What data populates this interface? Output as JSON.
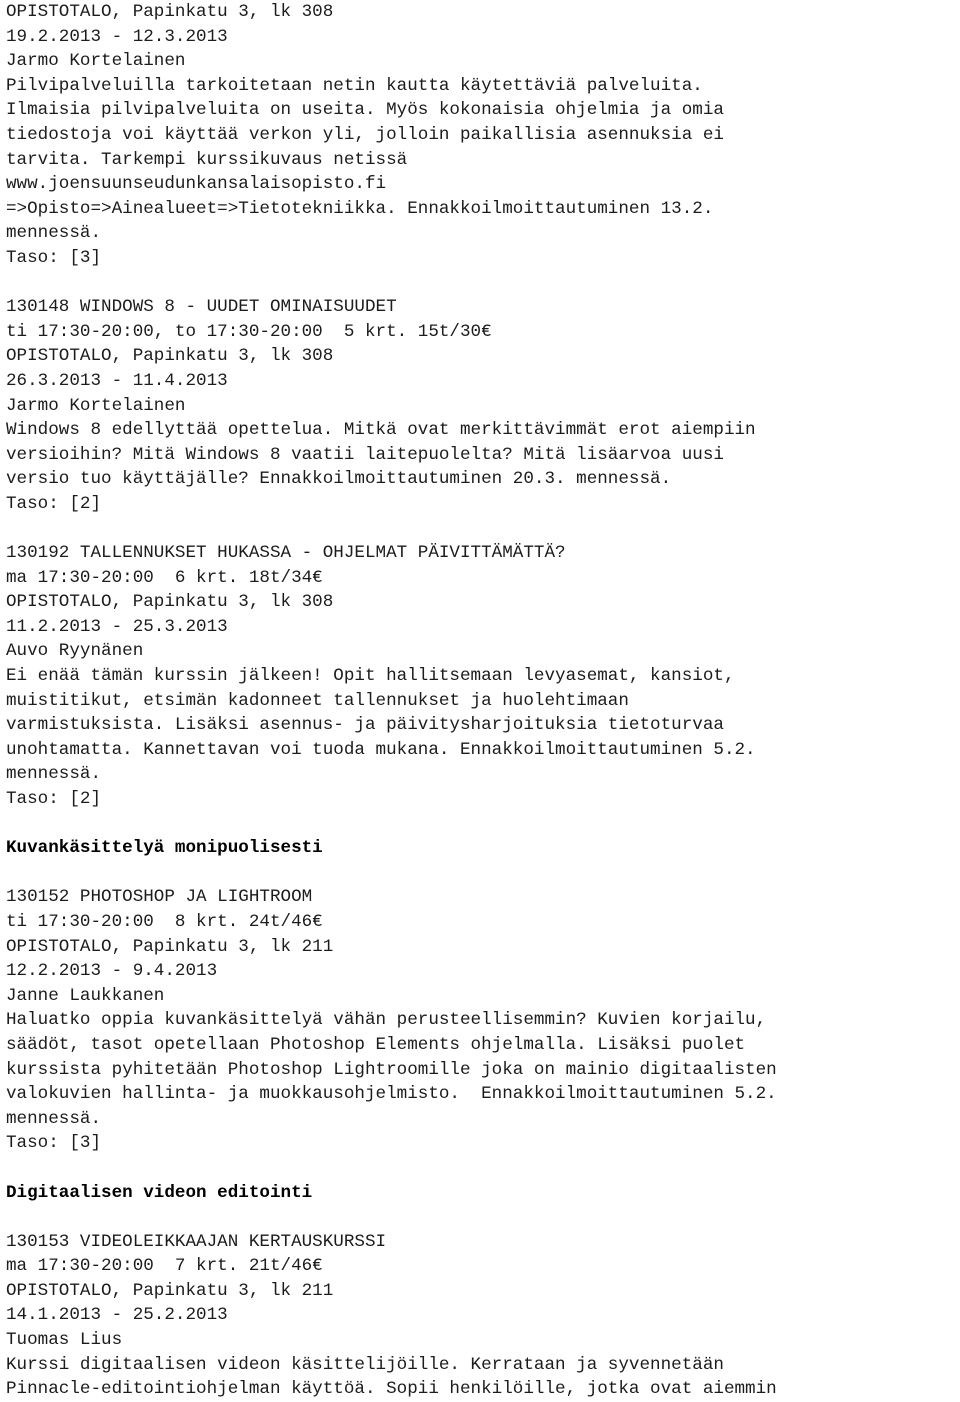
{
  "document": {
    "type": "course-catalog-listing",
    "language": "fi",
    "text_color": "#1c1c1c",
    "background_color": "#ffffff",
    "blocks": [
      {
        "kind": "line",
        "text": "OPISTOTALO, Papinkatu 3, lk 308"
      },
      {
        "kind": "line",
        "text": "19.2.2013 - 12.3.2013"
      },
      {
        "kind": "line",
        "text": "Jarmo Kortelainen"
      },
      {
        "kind": "line",
        "text": "Pilvipalveluilla tarkoitetaan netin kautta käytettäviä palveluita."
      },
      {
        "kind": "line",
        "text": "Ilmaisia pilvipalveluita on useita. Myös kokonaisia ohjelmia ja omia"
      },
      {
        "kind": "line",
        "text": "tiedostoja voi käyttää verkon yli, jolloin paikallisia asennuksia ei"
      },
      {
        "kind": "line",
        "text": "tarvita. Tarkempi kurssikuvaus netissä"
      },
      {
        "kind": "line",
        "text": "www.joensuunseudunkansalaisopisto.fi"
      },
      {
        "kind": "line",
        "text": "=>Opisto=>Ainealueet=>Tietotekniikka. Ennakkoilmoittautuminen 13.2."
      },
      {
        "kind": "line",
        "text": "mennessä."
      },
      {
        "kind": "line",
        "text": "Taso: [3]"
      },
      {
        "kind": "blank",
        "text": ""
      },
      {
        "kind": "line",
        "text": "130148 WINDOWS 8 - UUDET OMINAISUUDET"
      },
      {
        "kind": "line",
        "text": "ti 17:30-20:00, to 17:30-20:00  5 krt. 15t/30€"
      },
      {
        "kind": "line",
        "text": "OPISTOTALO, Papinkatu 3, lk 308"
      },
      {
        "kind": "line",
        "text": "26.3.2013 - 11.4.2013"
      },
      {
        "kind": "line",
        "text": "Jarmo Kortelainen"
      },
      {
        "kind": "line",
        "text": "Windows 8 edellyttää opettelua. Mitkä ovat merkittävimmät erot aiempiin"
      },
      {
        "kind": "line",
        "text": "versioihin? Mitä Windows 8 vaatii laitepuolelta? Mitä lisäarvoa uusi"
      },
      {
        "kind": "line",
        "text": "versio tuo käyttäjälle? Ennakkoilmoittautuminen 20.3. mennessä."
      },
      {
        "kind": "line",
        "text": "Taso: [2]"
      },
      {
        "kind": "blank",
        "text": ""
      },
      {
        "kind": "line",
        "text": "130192 TALLENNUKSET HUKASSA - OHJELMAT PÄIVITTÄMÄTTÄ?"
      },
      {
        "kind": "line",
        "text": "ma 17:30-20:00  6 krt. 18t/34€"
      },
      {
        "kind": "line",
        "text": "OPISTOTALO, Papinkatu 3, lk 308"
      },
      {
        "kind": "line",
        "text": "11.2.2013 - 25.3.2013"
      },
      {
        "kind": "line",
        "text": "Auvo Ryynänen"
      },
      {
        "kind": "line",
        "text": "Ei enää tämän kurssin jälkeen! Opit hallitsemaan levyasemat, kansiot,"
      },
      {
        "kind": "line",
        "text": "muistitikut, etsimän kadonneet tallennukset ja huolehtimaan"
      },
      {
        "kind": "line",
        "text": "varmistuksista. Lisäksi asennus- ja päivitysharjoituksia tietoturvaa"
      },
      {
        "kind": "line",
        "text": "unohtamatta. Kannettavan voi tuoda mukana. Ennakkoilmoittautuminen 5.2."
      },
      {
        "kind": "line",
        "text": "mennessä."
      },
      {
        "kind": "line",
        "text": "Taso: [2]"
      },
      {
        "kind": "blank",
        "text": ""
      },
      {
        "kind": "heading",
        "text": "Kuvankäsittelyä monipuolisesti"
      },
      {
        "kind": "blank",
        "text": ""
      },
      {
        "kind": "line",
        "text": "130152 PHOTOSHOP JA LIGHTROOM"
      },
      {
        "kind": "line",
        "text": "ti 17:30-20:00  8 krt. 24t/46€"
      },
      {
        "kind": "line",
        "text": "OPISTOTALO, Papinkatu 3, lk 211"
      },
      {
        "kind": "line",
        "text": "12.2.2013 - 9.4.2013"
      },
      {
        "kind": "line",
        "text": "Janne Laukkanen"
      },
      {
        "kind": "line",
        "text": "Haluatko oppia kuvankäsittelyä vähän perusteellisemmin? Kuvien korjailu,"
      },
      {
        "kind": "line",
        "text": "säädöt, tasot opetellaan Photoshop Elements ohjelmalla. Lisäksi puolet"
      },
      {
        "kind": "line",
        "text": "kurssista pyhitetään Photoshop Lightroomille joka on mainio digitaalisten"
      },
      {
        "kind": "line",
        "text": "valokuvien hallinta- ja muokkausohjelmisto.  Ennakkoilmoittautuminen 5.2."
      },
      {
        "kind": "line",
        "text": "mennessä."
      },
      {
        "kind": "line",
        "text": "Taso: [3]"
      },
      {
        "kind": "blank",
        "text": ""
      },
      {
        "kind": "heading",
        "text": "Digitaalisen videon editointi"
      },
      {
        "kind": "blank",
        "text": ""
      },
      {
        "kind": "line",
        "text": "130153 VIDEOLEIKKAAJAN KERTAUSKURSSI"
      },
      {
        "kind": "line",
        "text": "ma 17:30-20:00  7 krt. 21t/46€"
      },
      {
        "kind": "line",
        "text": "OPISTOTALO, Papinkatu 3, lk 211"
      },
      {
        "kind": "line",
        "text": "14.1.2013 - 25.2.2013"
      },
      {
        "kind": "line",
        "text": "Tuomas Lius"
      },
      {
        "kind": "line",
        "text": "Kurssi digitaalisen videon käsittelijöille. Kerrataan ja syvennetään"
      },
      {
        "kind": "line",
        "text": "Pinnacle-editointiohjelman käyttöä. Sopii henkilöille, jotka ovat aiemmin"
      }
    ]
  }
}
